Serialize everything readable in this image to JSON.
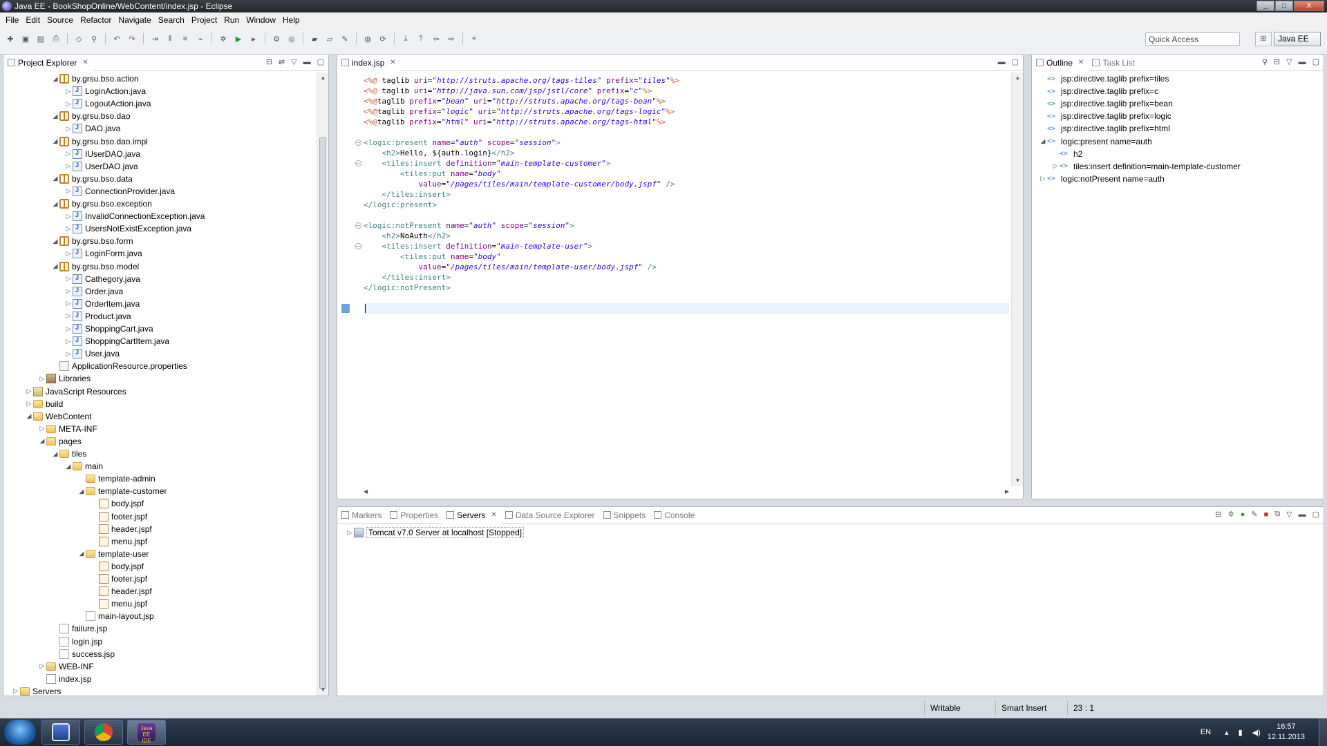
{
  "window": {
    "title": "Java EE - BookShopOnline/WebContent/index.jsp - Eclipse",
    "minimize": "_",
    "maximize": "□",
    "close": "X"
  },
  "menu": [
    "File",
    "Edit",
    "Source",
    "Refactor",
    "Navigate",
    "Search",
    "Project",
    "Run",
    "Window",
    "Help"
  ],
  "toolbar": {
    "quick_access_placeholder": "Quick Access",
    "perspective_label": "Java EE"
  },
  "project_explorer": {
    "tab_label": "Project Explorer",
    "tree": [
      {
        "label": "by.grsu.bso.action",
        "icon": "package-icon",
        "depth": 3,
        "twisty": "▲"
      },
      {
        "label": "LoginAction.java",
        "icon": "java-file-icon",
        "depth": 4,
        "twisty": "▷"
      },
      {
        "label": "LogoutAction.java",
        "icon": "java-file-icon",
        "depth": 4,
        "twisty": "▷"
      },
      {
        "label": "by.grsu.bso.dao",
        "icon": "package-icon",
        "depth": 3,
        "twisty": "▲"
      },
      {
        "label": "DAO.java",
        "icon": "java-file-icon",
        "depth": 4,
        "twisty": "▷"
      },
      {
        "label": "by.grsu.bso.dao.impl",
        "icon": "package-icon",
        "depth": 3,
        "twisty": "▲"
      },
      {
        "label": "IUserDAO.java",
        "icon": "java-file-icon",
        "depth": 4,
        "twisty": "▷"
      },
      {
        "label": "UserDAO.java",
        "icon": "java-file-icon",
        "depth": 4,
        "twisty": "▷"
      },
      {
        "label": "by.grsu.bso.data",
        "icon": "package-icon",
        "depth": 3,
        "twisty": "▲"
      },
      {
        "label": "ConnectionProvider.java",
        "icon": "java-file-icon",
        "depth": 4,
        "twisty": "▷"
      },
      {
        "label": "by.grsu.bso.exception",
        "icon": "package-icon",
        "depth": 3,
        "twisty": "▲"
      },
      {
        "label": "InvalidConnectionException.java",
        "icon": "java-file-icon",
        "depth": 4,
        "twisty": "▷"
      },
      {
        "label": "UsersNotExistException.java",
        "icon": "java-file-icon",
        "depth": 4,
        "twisty": "▷"
      },
      {
        "label": "by.grsu.bso.form",
        "icon": "package-icon",
        "depth": 3,
        "twisty": "▲"
      },
      {
        "label": "LoginForm.java",
        "icon": "java-file-icon",
        "depth": 4,
        "twisty": "▷"
      },
      {
        "label": "by.grsu.bso.model",
        "icon": "package-icon",
        "depth": 3,
        "twisty": "▲"
      },
      {
        "label": "Cathegory.java",
        "icon": "java-file-icon",
        "depth": 4,
        "twisty": "▷"
      },
      {
        "label": "Order.java",
        "icon": "java-file-icon",
        "depth": 4,
        "twisty": "▷"
      },
      {
        "label": "OrderItem.java",
        "icon": "java-file-icon",
        "depth": 4,
        "twisty": "▷"
      },
      {
        "label": "Product.java",
        "icon": "java-file-icon",
        "depth": 4,
        "twisty": "▷"
      },
      {
        "label": "ShoppingCart.java",
        "icon": "java-file-icon",
        "depth": 4,
        "twisty": "▷"
      },
      {
        "label": "ShoppingCartItem.java",
        "icon": "java-file-icon",
        "depth": 4,
        "twisty": "▷"
      },
      {
        "label": "User.java",
        "icon": "java-file-icon",
        "depth": 4,
        "twisty": "▷"
      },
      {
        "label": "ApplicationResource.properties",
        "icon": "properties-file-icon",
        "depth": 3,
        "twisty": ""
      },
      {
        "label": "Libraries",
        "icon": "library-icon",
        "depth": 2,
        "twisty": "▷"
      },
      {
        "label": "JavaScript Resources",
        "icon": "javascript-resources-icon",
        "depth": 1,
        "twisty": "▷"
      },
      {
        "label": "build",
        "icon": "folder-icon",
        "depth": 1,
        "twisty": "▷"
      },
      {
        "label": "WebContent",
        "icon": "folder-icon",
        "depth": 1,
        "twisty": "▲"
      },
      {
        "label": "META-INF",
        "icon": "folder-icon",
        "depth": 2,
        "twisty": "▷"
      },
      {
        "label": "pages",
        "icon": "folder-icon",
        "depth": 2,
        "twisty": "▲"
      },
      {
        "label": "tiles",
        "icon": "folder-icon",
        "depth": 3,
        "twisty": "▲"
      },
      {
        "label": "main",
        "icon": "folder-icon",
        "depth": 4,
        "twisty": "▲"
      },
      {
        "label": "template-admin",
        "icon": "folder-icon",
        "depth": 5,
        "twisty": ""
      },
      {
        "label": "template-customer",
        "icon": "folder-icon",
        "depth": 5,
        "twisty": "▲"
      },
      {
        "label": "body.jspf",
        "icon": "jspf-file-icon",
        "depth": 6,
        "twisty": ""
      },
      {
        "label": "footer.jspf",
        "icon": "jspf-file-icon",
        "depth": 6,
        "twisty": ""
      },
      {
        "label": "header.jspf",
        "icon": "jspf-file-icon",
        "depth": 6,
        "twisty": ""
      },
      {
        "label": "menu.jspf",
        "icon": "jspf-file-icon",
        "depth": 6,
        "twisty": ""
      },
      {
        "label": "template-user",
        "icon": "folder-icon",
        "depth": 5,
        "twisty": "▲"
      },
      {
        "label": "body.jspf",
        "icon": "jspf-file-icon",
        "depth": 6,
        "twisty": ""
      },
      {
        "label": "footer.jspf",
        "icon": "jspf-file-icon",
        "depth": 6,
        "twisty": ""
      },
      {
        "label": "header.jspf",
        "icon": "jspf-file-icon",
        "depth": 6,
        "twisty": ""
      },
      {
        "label": "menu.jspf",
        "icon": "jspf-file-icon",
        "depth": 6,
        "twisty": ""
      },
      {
        "label": "main-layout.jsp",
        "icon": "jsp-file-icon",
        "depth": 5,
        "twisty": ""
      },
      {
        "label": "failure.jsp",
        "icon": "jsp-file-icon",
        "depth": 3,
        "twisty": ""
      },
      {
        "label": "login.jsp",
        "icon": "jsp-file-icon",
        "depth": 3,
        "twisty": ""
      },
      {
        "label": "success.jsp",
        "icon": "jsp-file-icon",
        "depth": 3,
        "twisty": ""
      },
      {
        "label": "WEB-INF",
        "icon": "folder-icon",
        "depth": 2,
        "twisty": "▷"
      },
      {
        "label": "index.jsp",
        "icon": "jsp-file-icon",
        "depth": 2,
        "twisty": ""
      },
      {
        "label": "Servers",
        "icon": "servers-project-icon",
        "depth": 0,
        "twisty": "▷"
      }
    ]
  },
  "editor": {
    "tab_label": "index.jsp",
    "lines": [
      [
        [
          "dir",
          "<%@ "
        ],
        [
          "txt",
          "taglib "
        ],
        [
          "attr",
          "uri"
        ],
        [
          "txt",
          "="
        ],
        [
          "val",
          "\"http://struts.apache.org/tags-tiles\""
        ],
        [
          "txt",
          " "
        ],
        [
          "attr",
          "prefix"
        ],
        [
          "txt",
          "="
        ],
        [
          "val",
          "\"tiles\""
        ],
        [
          "dir",
          "%>"
        ]
      ],
      [
        [
          "dir",
          "<%@ "
        ],
        [
          "txt",
          "taglib "
        ],
        [
          "attr",
          "uri"
        ],
        [
          "txt",
          "="
        ],
        [
          "val",
          "\"http://java.sun.com/jsp/jstl/core\""
        ],
        [
          "txt",
          " "
        ],
        [
          "attr",
          "prefix"
        ],
        [
          "txt",
          "="
        ],
        [
          "val",
          "\"c\""
        ],
        [
          "dir",
          "%>"
        ]
      ],
      [
        [
          "dir",
          "<%@"
        ],
        [
          "txt",
          "taglib "
        ],
        [
          "attr",
          "prefix"
        ],
        [
          "txt",
          "="
        ],
        [
          "val",
          "\"bean\""
        ],
        [
          "txt",
          " "
        ],
        [
          "attr",
          "uri"
        ],
        [
          "txt",
          "="
        ],
        [
          "val",
          "\"http://struts.apache.org/tags-bean\""
        ],
        [
          "dir",
          "%>"
        ]
      ],
      [
        [
          "dir",
          "<%@"
        ],
        [
          "txt",
          "taglib "
        ],
        [
          "attr",
          "prefix"
        ],
        [
          "txt",
          "="
        ],
        [
          "val",
          "\"logic\""
        ],
        [
          "txt",
          " "
        ],
        [
          "attr",
          "uri"
        ],
        [
          "txt",
          "="
        ],
        [
          "val",
          "\"http://struts.apache.org/tags-logic\""
        ],
        [
          "dir",
          "%>"
        ]
      ],
      [
        [
          "dir",
          "<%@"
        ],
        [
          "txt",
          "taglib "
        ],
        [
          "attr",
          "prefix"
        ],
        [
          "txt",
          "="
        ],
        [
          "val",
          "\"html\""
        ],
        [
          "txt",
          " "
        ],
        [
          "attr",
          "uri"
        ],
        [
          "txt",
          "="
        ],
        [
          "val",
          "\"http://struts.apache.org/tags-html\""
        ],
        [
          "dir",
          "%>"
        ]
      ],
      [],
      [
        [
          "tag",
          "<logic:present "
        ],
        [
          "attr",
          "name"
        ],
        [
          "txt",
          "="
        ],
        [
          "val",
          "\"auth\""
        ],
        [
          "txt",
          " "
        ],
        [
          "attr",
          "scope"
        ],
        [
          "txt",
          "="
        ],
        [
          "val",
          "\"session\""
        ],
        [
          "tag",
          ">"
        ]
      ],
      [
        [
          "txt",
          "    "
        ],
        [
          "tag",
          "<h2>"
        ],
        [
          "txt",
          "Hello, ${auth.login}"
        ],
        [
          "tag",
          "</h2>"
        ]
      ],
      [
        [
          "txt",
          "    "
        ],
        [
          "tag",
          "<tiles:insert "
        ],
        [
          "attr",
          "definition"
        ],
        [
          "txt",
          "="
        ],
        [
          "val",
          "\"main-template-customer\""
        ],
        [
          "tag",
          ">"
        ]
      ],
      [
        [
          "txt",
          "        "
        ],
        [
          "tag",
          "<tiles:put "
        ],
        [
          "attr",
          "name"
        ],
        [
          "txt",
          "="
        ],
        [
          "val",
          "\"body\""
        ]
      ],
      [
        [
          "txt",
          "            "
        ],
        [
          "attr",
          "value"
        ],
        [
          "txt",
          "="
        ],
        [
          "val",
          "\"/pages/tiles/main/template-customer/body.jspf\""
        ],
        [
          "tag",
          " />"
        ]
      ],
      [
        [
          "txt",
          "    "
        ],
        [
          "tag",
          "</tiles:insert>"
        ]
      ],
      [
        [
          "tag",
          "</logic:present>"
        ]
      ],
      [],
      [
        [
          "tag",
          "<logic:notPresent "
        ],
        [
          "attr",
          "name"
        ],
        [
          "txt",
          "="
        ],
        [
          "val",
          "\"auth\""
        ],
        [
          "txt",
          " "
        ],
        [
          "attr",
          "scope"
        ],
        [
          "txt",
          "="
        ],
        [
          "val",
          "\"session\""
        ],
        [
          "tag",
          ">"
        ]
      ],
      [
        [
          "txt",
          "    "
        ],
        [
          "tag",
          "<h2>"
        ],
        [
          "txt",
          "NoAuth"
        ],
        [
          "tag",
          "</h2>"
        ]
      ],
      [
        [
          "txt",
          "    "
        ],
        [
          "tag",
          "<tiles:insert "
        ],
        [
          "attr",
          "definition"
        ],
        [
          "txt",
          "="
        ],
        [
          "val",
          "\"main-template-user\""
        ],
        [
          "tag",
          ">"
        ]
      ],
      [
        [
          "txt",
          "        "
        ],
        [
          "tag",
          "<tiles:put "
        ],
        [
          "attr",
          "name"
        ],
        [
          "txt",
          "="
        ],
        [
          "val",
          "\"body\""
        ]
      ],
      [
        [
          "txt",
          "            "
        ],
        [
          "attr",
          "value"
        ],
        [
          "txt",
          "="
        ],
        [
          "val",
          "\"/pages/tiles/main/template-user/body.jspf\""
        ],
        [
          "tag",
          " />"
        ]
      ],
      [
        [
          "txt",
          "    "
        ],
        [
          "tag",
          "</tiles:insert>"
        ]
      ],
      [
        [
          "tag",
          "</logic:notPresent>"
        ]
      ],
      [],
      []
    ],
    "fold_lines": [
      7,
      9,
      15,
      17
    ],
    "current_line": 23
  },
  "outline": {
    "tab_label": "Outline",
    "task_list_label": "Task List",
    "items": [
      {
        "label": "jsp:directive.taglib prefix=tiles",
        "depth": 0,
        "twisty": ""
      },
      {
        "label": "jsp:directive.taglib prefix=c",
        "depth": 0,
        "twisty": ""
      },
      {
        "label": "jsp:directive.taglib prefix=bean",
        "depth": 0,
        "twisty": ""
      },
      {
        "label": "jsp:directive.taglib prefix=logic",
        "depth": 0,
        "twisty": ""
      },
      {
        "label": "jsp:directive.taglib prefix=html",
        "depth": 0,
        "twisty": ""
      },
      {
        "label": "logic:present name=auth",
        "depth": 0,
        "twisty": "▲"
      },
      {
        "label": "h2",
        "depth": 1,
        "twisty": ""
      },
      {
        "label": "tiles:insert definition=main-template-customer",
        "depth": 1,
        "twisty": "▷"
      },
      {
        "label": "logic:notPresent name=auth",
        "depth": 0,
        "twisty": "▷"
      }
    ]
  },
  "bottom_panel": {
    "tabs": [
      "Markers",
      "Properties",
      "Servers",
      "Data Source Explorer",
      "Snippets",
      "Console"
    ],
    "active_tab": 2,
    "server_entry": "Tomcat v7.0 Server at localhost  [Stopped]"
  },
  "statusbar": {
    "mode": "Writable",
    "insert_mode": "Smart Insert",
    "position": "23 : 1"
  },
  "taskbar": {
    "language": "EN",
    "time": "16:57",
    "date": "12.11.2013",
    "eclipse_button_label": "Java EE IDE"
  },
  "colors": {
    "tag": "#3f7f7f",
    "attr": "#7f007f",
    "value": "#2a00ff",
    "directive": "#bf5f3f"
  }
}
